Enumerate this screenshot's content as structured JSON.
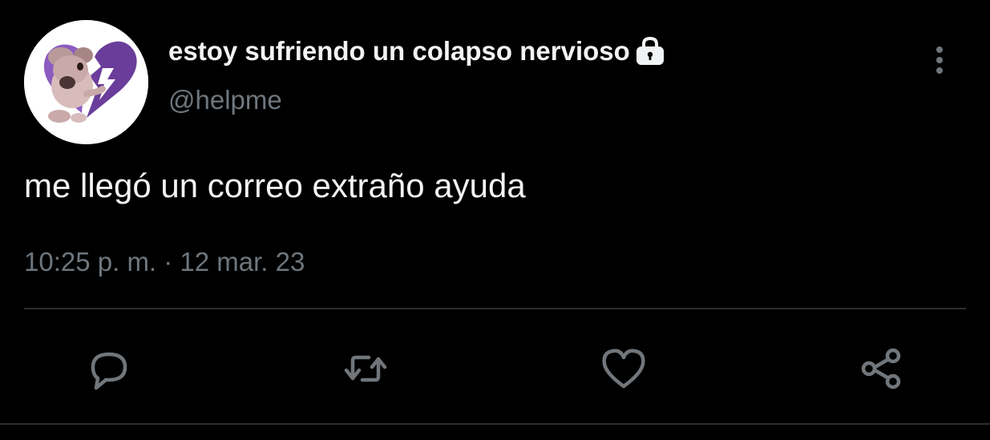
{
  "tweet": {
    "author": {
      "display_name": "estoy sufriendo un colapso nervioso",
      "handle": "@helpme",
      "protected_icon": "lock-icon",
      "avatar_description": "avatar-image"
    },
    "text": "me llegó un correo extraño ayuda",
    "timestamp": "10:25 p. m. · 12 mar. 23",
    "menu_icon": "more-vertical-icon",
    "actions": [
      {
        "name": "reply",
        "icon": "reply-icon"
      },
      {
        "name": "retweet",
        "icon": "retweet-icon"
      },
      {
        "name": "like",
        "icon": "heart-icon"
      },
      {
        "name": "share",
        "icon": "share-icon"
      }
    ]
  },
  "colors": {
    "background": "#000000",
    "primary_text": "#f2f3f5",
    "secondary_text": "#6e767d",
    "icon": "#71767b",
    "divider": "#2b2f33",
    "avatar_heart": "#7b4fa8"
  }
}
